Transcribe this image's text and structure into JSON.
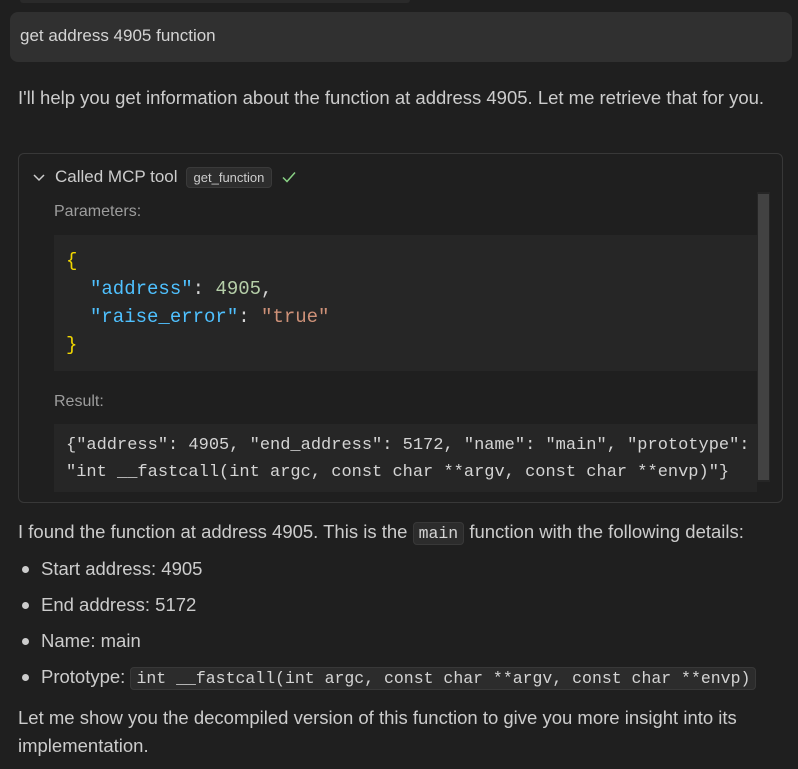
{
  "user_message": "get address 4905 function",
  "intro_text": "I'll help you get information about the function at address 4905. Let me retrieve that for you.",
  "tool_call": {
    "header_label": "Called MCP tool",
    "tool_name": "get_function",
    "status": "success",
    "parameters_label": "Parameters:",
    "parameters": {
      "open_brace": "{",
      "address_key": "\"address\"",
      "address_value": "4905",
      "raise_error_key": "\"raise_error\"",
      "raise_error_value": "\"true\"",
      "close_brace": "}"
    },
    "result_label": "Result:",
    "result_line1": "{\"address\": 4905, \"end_address\": 5172, \"name\": \"main\", \"prototype\":",
    "result_line2": "\"int __fastcall(int argc, const char **argv, const char **envp)\"}"
  },
  "summary": {
    "prefix": "I found the function at address 4905. This is the",
    "function_name": "main",
    "suffix": "function with the following details:"
  },
  "details": [
    {
      "label": "Start address: 4905"
    },
    {
      "label": "End address: 5172"
    },
    {
      "label": "Name: main"
    },
    {
      "label": "Prototype:",
      "code": "int __fastcall(int argc, const char **argv, const char **envp)"
    }
  ],
  "closing_text": "Let me show you the decompiled version of this function to give you more insight into its implementation.",
  "colors": {
    "background": "#1f1f1f",
    "user_bubble": "#303030",
    "code_bg": "#262626",
    "json_key": "#4fc1ff",
    "json_number": "#b5cea8",
    "json_string": "#ce9178",
    "json_brace": "#f1d700",
    "success_check": "#89d185"
  }
}
